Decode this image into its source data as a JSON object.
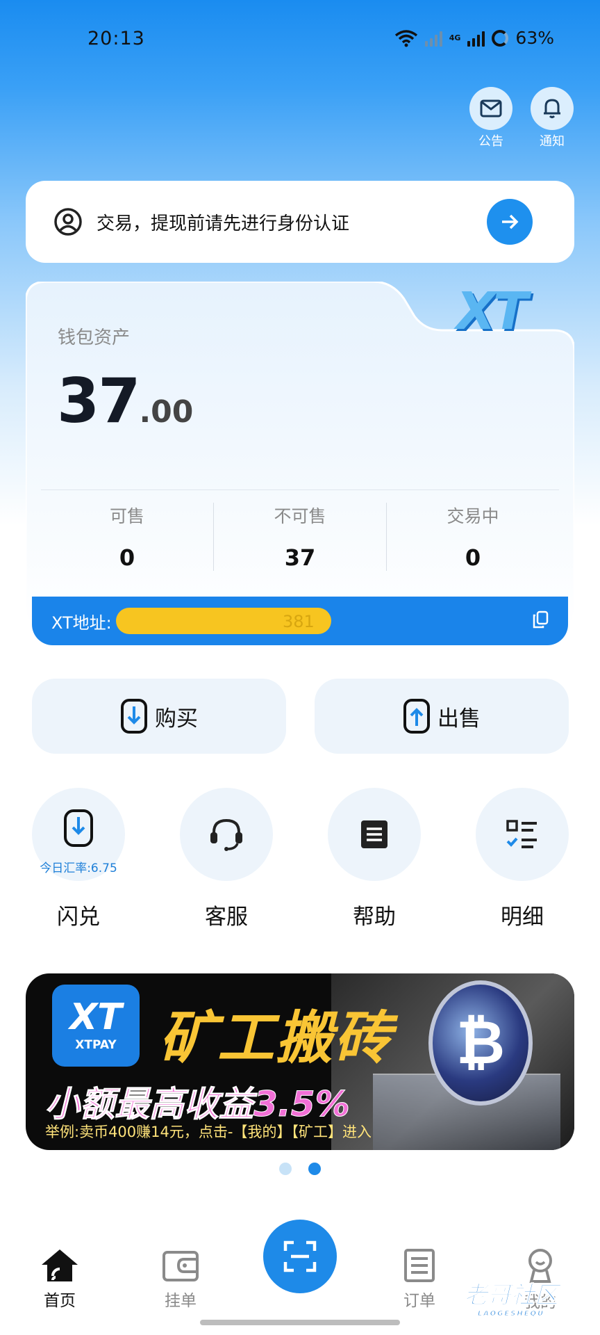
{
  "status_bar": {
    "time": "20:13",
    "network": "4G",
    "battery": "63%"
  },
  "top_actions": [
    {
      "label": "公告",
      "icon": "mail-icon"
    },
    {
      "label": "通知",
      "icon": "bell-icon"
    }
  ],
  "verify_banner": {
    "text": "交易，提现前请先进行身份认证",
    "icon": "user-circle-icon"
  },
  "wallet": {
    "logo": "XT",
    "label": "钱包资产",
    "balance_int": "37",
    "balance_dec": ".00",
    "stats": [
      {
        "label": "可售",
        "value": "0"
      },
      {
        "label": "不可售",
        "value": "37"
      },
      {
        "label": "交易中",
        "value": "0"
      }
    ],
    "address_label": "XT地址:",
    "address_value": "381"
  },
  "trade_buttons": [
    {
      "label": "购买",
      "icon": "download-box-icon"
    },
    {
      "label": "出售",
      "icon": "upload-box-icon"
    }
  ],
  "quick_actions": [
    {
      "label": "闪兑",
      "icon": "exchange-icon",
      "rate": "今日汇率:6.75"
    },
    {
      "label": "客服",
      "icon": "headset-icon"
    },
    {
      "label": "帮助",
      "icon": "document-icon"
    },
    {
      "label": "明细",
      "icon": "checklist-icon"
    }
  ],
  "banner": {
    "logo_big": "XT",
    "logo_small": "XTPAY",
    "title": "矿工搬砖",
    "subtitle": "小额最高收益3.5%",
    "note": "举例:卖币400赚14元，点击-【我的】【矿工】进入",
    "coin_symbol": "₿"
  },
  "carousel": {
    "count": 2,
    "active": 1
  },
  "tabbar": [
    {
      "label": "首页",
      "icon": "home-icon",
      "active": true
    },
    {
      "label": "挂单",
      "icon": "wallet-icon",
      "active": false
    },
    {
      "label": "订单",
      "icon": "list-icon",
      "active": false
    },
    {
      "label": "我的",
      "icon": "user-icon",
      "active": false
    }
  ],
  "watermark": {
    "text": "老哥社区",
    "sub": "LAOGESHEQU"
  },
  "colors": {
    "primary": "#1e8ae8",
    "highlight": "#f7c520"
  }
}
